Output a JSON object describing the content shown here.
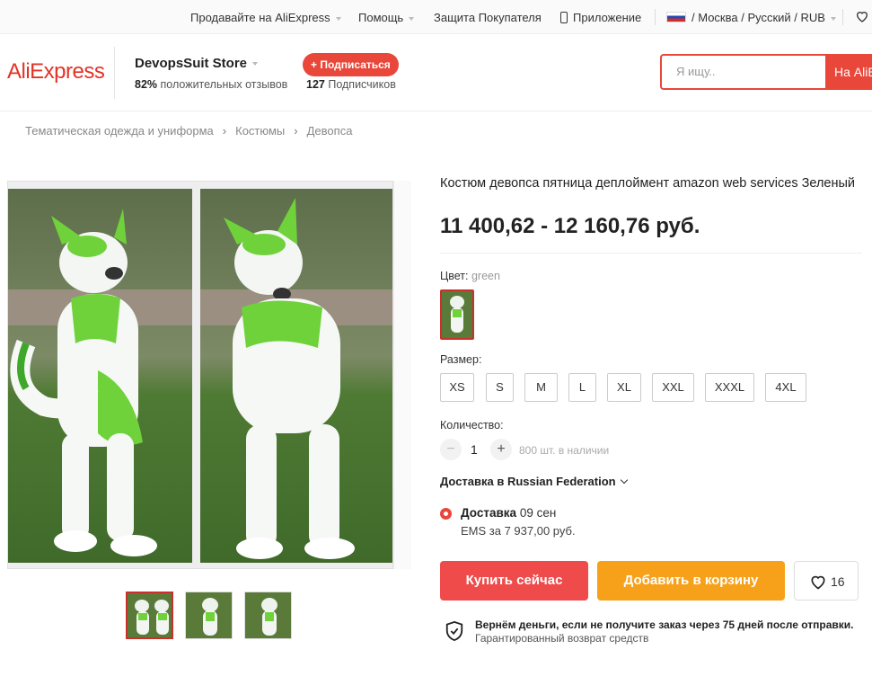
{
  "topbar": {
    "sell": "Продавайте на AliExpress",
    "help": "Помощь",
    "protection": "Защита Покупателя",
    "app": "Приложение",
    "locale": "/ Москва / Русский / RUB"
  },
  "header": {
    "logo": "AliExpress",
    "store_name": "DevopsSuit Store",
    "rating_percent": "82%",
    "rating_text": "положительных отзывов",
    "subscribe_label": "+ Подписаться",
    "subscribers_count": "127",
    "subscribers_text": "Подписчиков",
    "search_placeholder": "Я ищу..",
    "search_button": "На AliExpress"
  },
  "breadcrumb": [
    "Тематическая одежда и униформа",
    "Костюмы",
    "Девопса"
  ],
  "product": {
    "title": "Костюм девопса пятница деплоймент amazon web services Зеленый",
    "price": "11 400,62 - 12 160,76 руб.",
    "color_label": "Цвет:",
    "color_value": "green",
    "size_label": "Размер:",
    "sizes": [
      "XS",
      "S",
      "M",
      "L",
      "XL",
      "XXL",
      "XXXL",
      "4XL"
    ],
    "quantity_label": "Количество:",
    "quantity": "1",
    "minus": "−",
    "plus": "+",
    "stock": "800 шт. в наличии",
    "delivery_to": "Доставка в Russian Federation",
    "delivery_label": "Доставка",
    "delivery_date": "09 сен",
    "delivery_method": "EMS за 7 937,00 руб.",
    "buy_now": "Купить сейчас",
    "add_to_cart": "Добавить в корзину",
    "wishlist_count": "16",
    "guarantee_title": "Вернём деньги, если не получите заказ через 75 дней после отправки.",
    "guarantee_sub": "Гарантированный возврат средств"
  },
  "colors": {
    "accent": "#e9473a",
    "buy": "#ef4b4b",
    "cart": "#f7a11a"
  }
}
